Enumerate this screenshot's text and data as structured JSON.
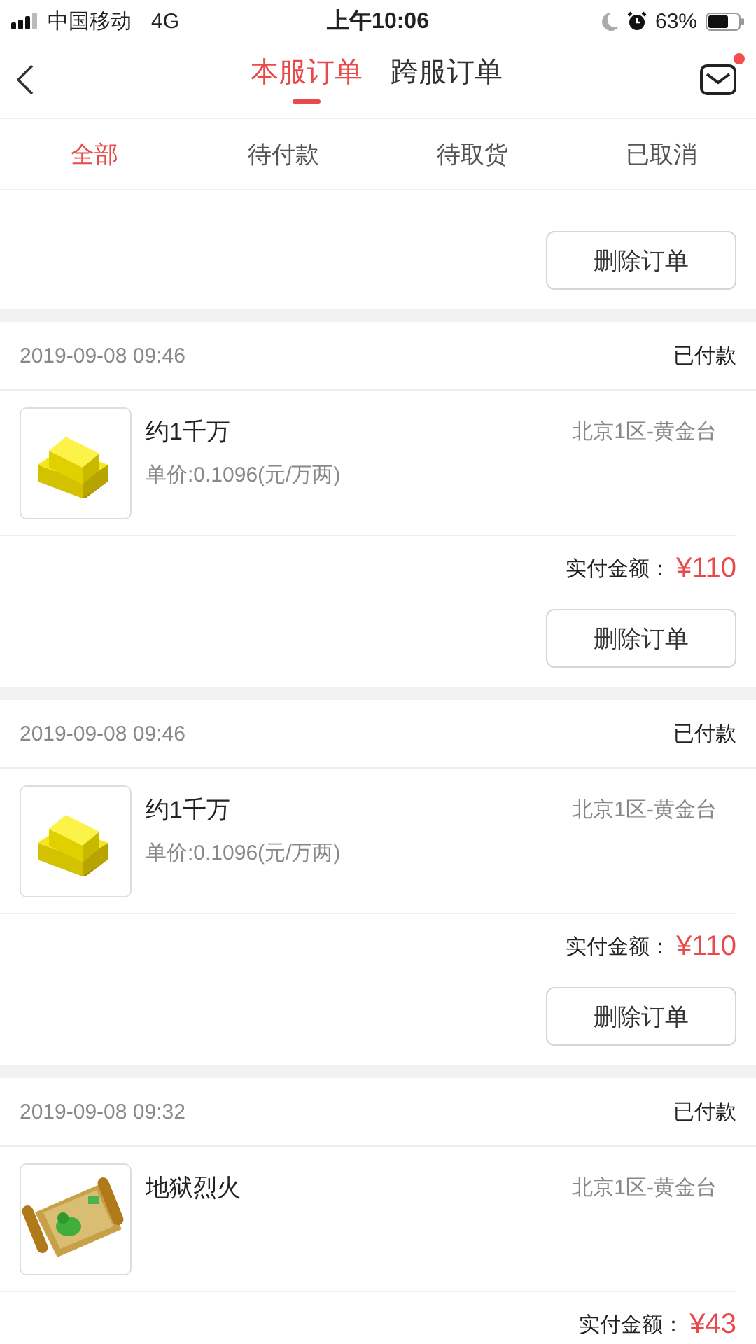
{
  "status_bar": {
    "carrier": "中国移动",
    "network": "4G",
    "time": "上午10:06",
    "battery_percent": "63%"
  },
  "nav": {
    "tabs": [
      {
        "label": "本服订单",
        "selected": true
      },
      {
        "label": "跨服订单",
        "selected": false
      }
    ],
    "mail_unread": true
  },
  "filters": [
    {
      "label": "全部",
      "selected": true
    },
    {
      "label": "待付款",
      "selected": false
    },
    {
      "label": "待取货",
      "selected": false
    },
    {
      "label": "已取消",
      "selected": false
    }
  ],
  "orders": [
    {
      "delete_label": "删除订单"
    },
    {
      "date": "2019-09-08 09:46",
      "status": "已付款",
      "product": {
        "kind": "gold",
        "name": "约1千万",
        "unit_price": "单价:0.1096(元/万两)",
        "server": "北京1区-黄金台"
      },
      "total_label": "实付金额：",
      "total": "¥110",
      "delete_label": "删除订单"
    },
    {
      "date": "2019-09-08 09:46",
      "status": "已付款",
      "product": {
        "kind": "gold",
        "name": "约1千万",
        "unit_price": "单价:0.1096(元/万两)",
        "server": "北京1区-黄金台"
      },
      "total_label": "实付金额：",
      "total": "¥110",
      "delete_label": "删除订单"
    },
    {
      "date": "2019-09-08 09:32",
      "status": "已付款",
      "product": {
        "kind": "scroll",
        "name": "地狱烈火",
        "server": "北京1区-黄金台"
      },
      "total_label": "实付金额：",
      "total": "¥43"
    }
  ]
}
